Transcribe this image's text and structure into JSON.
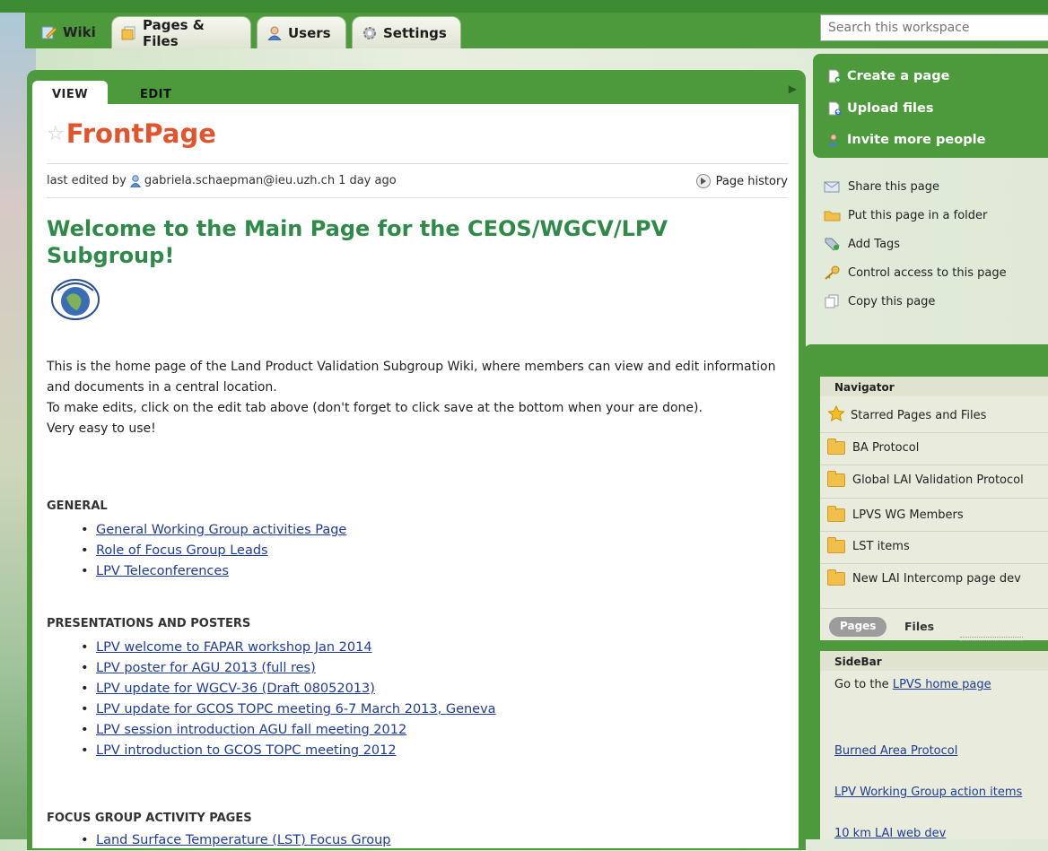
{
  "tabs": [
    {
      "label": "Wiki",
      "icon": "pencil-page-icon",
      "active": true
    },
    {
      "label": "Pages & Files",
      "icon": "pages-icon"
    },
    {
      "label": "Users",
      "icon": "users-icon"
    },
    {
      "label": "Settings",
      "icon": "gear-icon"
    }
  ],
  "search": {
    "placeholder": "Search this workspace"
  },
  "subtabs": {
    "view": "VIEW",
    "edit": "EDIT"
  },
  "page": {
    "title": "FrontPage",
    "last_edited_prefix": "last edited by",
    "editor": "gabriela.schaepman@ieu.uzh.ch",
    "edited_ago": "1 day ago",
    "history_label": "Page history",
    "heading": "Welcome to the Main Page for the CEOS/WGCV/LPV Subgroup!",
    "intro": [
      "This is the home page of the Land Product Validation Subgroup Wiki, where members can view and edit information and documents in a central location.",
      "To make edits, click on the edit tab above (don't forget to click save at the bottom when your are done).",
      "Very easy to use!"
    ],
    "sections": [
      {
        "title": "GENERAL",
        "links": [
          "General Working Group activities Page",
          "Role of Focus Group Leads ",
          "LPV Teleconferences"
        ]
      },
      {
        "title": "PRESENTATIONS AND POSTERS",
        "links": [
          "LPV welcome to FAPAR workshop Jan 2014",
          "LPV poster for AGU 2013 (full res)",
          "LPV update for WGCV-36 (Draft 08052013)",
          "LPV update for GCOS TOPC meeting 6-7 March 2013, Geneva",
          "LPV session introduction AGU fall meeting 2012",
          "LPV introduction to GCOS TOPC meeting 2012"
        ]
      },
      {
        "title": "FOCUS GROUP ACTIVITY PAGES",
        "links": [
          "Land Surface Temperature (LST) Focus Group"
        ]
      }
    ]
  },
  "actions": [
    "Create a page",
    "Upload files",
    "Invite more people"
  ],
  "page_tools": [
    "Share this page",
    "Put this page in a folder",
    "Add Tags",
    "Control access to this page",
    "Copy this page"
  ],
  "navigator": {
    "title": "Navigator",
    "items": [
      "Starred Pages and Files",
      "BA Protocol",
      "Global LAI Validation Protocol",
      "LPVS WG Members",
      "LST items",
      "New LAI Intercomp page dev"
    ],
    "pages_tab": "Pages",
    "files_tab": "Files"
  },
  "sidebar": {
    "title": "SideBar",
    "goto_prefix": "Go to the",
    "goto_link": "LPVS home page",
    "links": [
      "Burned Area Protocol",
      "LPV Working Group action items",
      "10 km LAI web dev"
    ]
  }
}
